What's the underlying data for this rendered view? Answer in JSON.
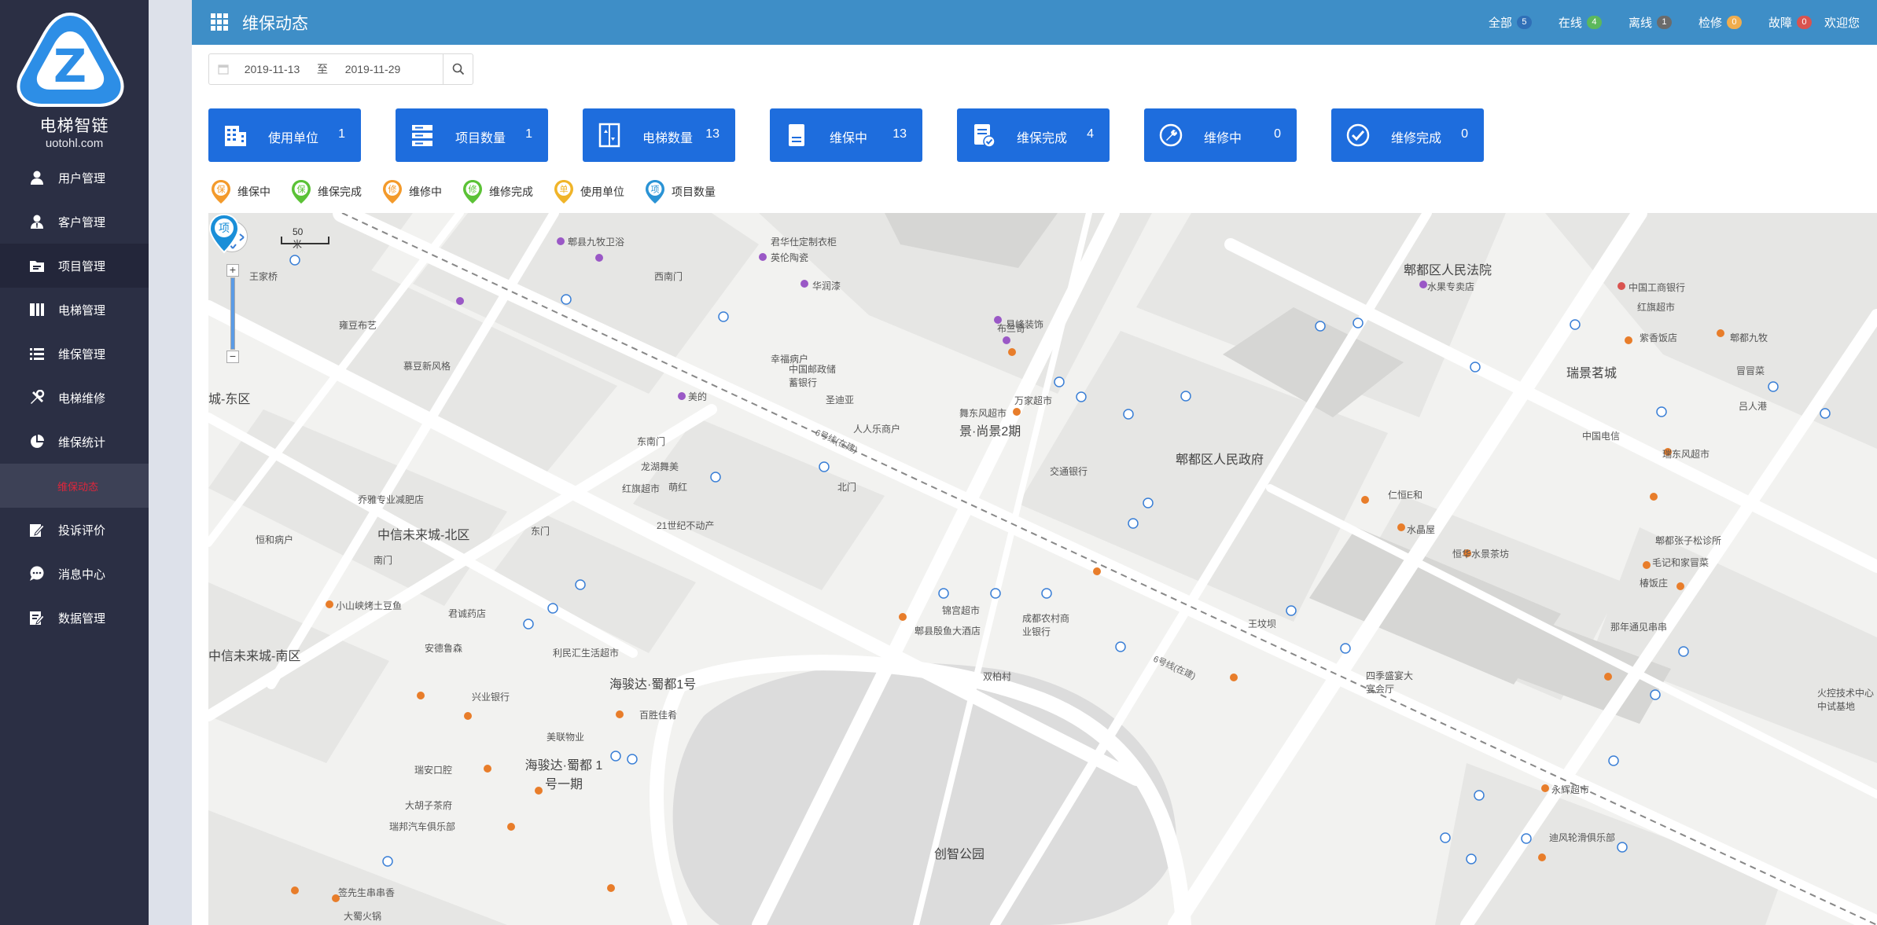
{
  "brand": {
    "name": "电梯智链",
    "url": "uotohl.com",
    "logo_letter": "Z"
  },
  "sidebar": {
    "items": [
      {
        "label": "用户管理",
        "icon": "user-icon"
      },
      {
        "label": "客户管理",
        "icon": "customer-icon"
      },
      {
        "label": "项目管理",
        "icon": "folder-icon"
      },
      {
        "label": "电梯管理",
        "icon": "elevator-icon"
      },
      {
        "label": "维保管理",
        "icon": "list-icon"
      },
      {
        "label": "电梯维修",
        "icon": "tools-icon"
      },
      {
        "label": "维保统计",
        "icon": "pie-chart-icon"
      },
      {
        "label": "投诉评价",
        "icon": "edit-icon"
      },
      {
        "label": "消息中心",
        "icon": "chat-icon"
      },
      {
        "label": "数据管理",
        "icon": "data-icon"
      }
    ],
    "active_submenu": "维保动态"
  },
  "header": {
    "title": "维保动态",
    "status": [
      {
        "label": "全部",
        "count": "5",
        "color": "#2f6fb7"
      },
      {
        "label": "在线",
        "count": "4",
        "color": "#5cb85c"
      },
      {
        "label": "离线",
        "count": "1",
        "color": "#6b6b6b"
      },
      {
        "label": "检修",
        "count": "0",
        "color": "#f0ad4e"
      },
      {
        "label": "故障",
        "count": "0",
        "color": "#d9534f"
      }
    ],
    "welcome": "欢迎您"
  },
  "date_filter": {
    "start": "2019-11-13",
    "separator": "至",
    "end": "2019-11-29"
  },
  "stat_cards": [
    {
      "label": "使用单位",
      "value": "1",
      "icon": "building-icon"
    },
    {
      "label": "项目数量",
      "value": "1",
      "icon": "server-icon"
    },
    {
      "label": "电梯数量",
      "value": "13",
      "icon": "elevator-icon"
    },
    {
      "label": "维保中",
      "value": "13",
      "icon": "document-icon"
    },
    {
      "label": "维保完成",
      "value": "4",
      "icon": "document-check-icon"
    },
    {
      "label": "维修中",
      "value": "0",
      "icon": "wrench-icon"
    },
    {
      "label": "维修完成",
      "value": "0",
      "icon": "wrench-check-icon"
    }
  ],
  "legend": [
    {
      "label": "维保中",
      "glyph": "保",
      "color": "#f39a2b"
    },
    {
      "label": "维保完成",
      "glyph": "保",
      "color": "#5bc236"
    },
    {
      "label": "维修中",
      "glyph": "修",
      "color": "#f39a2b"
    },
    {
      "label": "维修完成",
      "glyph": "修",
      "color": "#5bc236"
    },
    {
      "label": "使用单位",
      "glyph": "单",
      "color": "#f0b429"
    },
    {
      "label": "项目数量",
      "glyph": "项",
      "color": "#2a93d5"
    }
  ],
  "map": {
    "scale_label": "50 米",
    "zoom_in": "+",
    "zoom_out": "−",
    "marker_glyph": "项",
    "labels": [
      "城-东区",
      "中信未来城-北区",
      "中信未来城-南区",
      "王家桥",
      "景·尚景2期",
      "郫都区人民政府",
      "郫都区人民法院",
      "瑞景茗城",
      "海骏达·蜀都1号",
      "海骏达·蜀都 1号一期",
      "创智公园",
      "双柏村",
      "6号线(在建)",
      "6号线(在建)",
      "西南门",
      "东南门",
      "北门",
      "南门",
      "东门",
      "王坟坝",
      "中国工商银行",
      "红旗超市",
      "交通银行",
      "中国电信",
      "水晶屋",
      "仁恒E和",
      "成都农村商业银行",
      "锦宫超市",
      "郫县殷鱼大酒店",
      "中国邮政储蓄银行",
      "四季盛宴大宴会厅",
      "永辉超市",
      "迪风轮滑俱乐部",
      "火控技术中心中试基地",
      "小山峡烤土豆鱼",
      "君诚药店",
      "安德鲁森",
      "兴业银行",
      "瑞安口腔",
      "大胡子茶府",
      "瑞邦汽车俱乐部",
      "签先生串串香",
      "大蜀火锅",
      "百胜佳肴",
      "美联物业",
      "利民汇生活超市",
      "21世纪不动产",
      "红旗超市",
      "龙湖舞美",
      "圣迪亚",
      "舞东风超市",
      "人人乐商户",
      "乔雅专业减肥店",
      "恒和病户",
      "郫县九牧卫浴",
      "英伦陶瓷",
      "华润漆",
      "易峰装饰",
      "美的",
      "萌红",
      "布兰奇",
      "幸福病户",
      "万家超市",
      "郫都张子松诊所",
      "毛记和家冒菜",
      "椿饭庄",
      "那年通见串串",
      "恒华水景茶坊",
      "瑞东风超市",
      "郫都九牧",
      "吕人港",
      "冒冒菜",
      "紫香饭店",
      "水果专卖店",
      "雍豆布艺",
      "慕豆新风格",
      "君华仕定制衣柜"
    ]
  }
}
